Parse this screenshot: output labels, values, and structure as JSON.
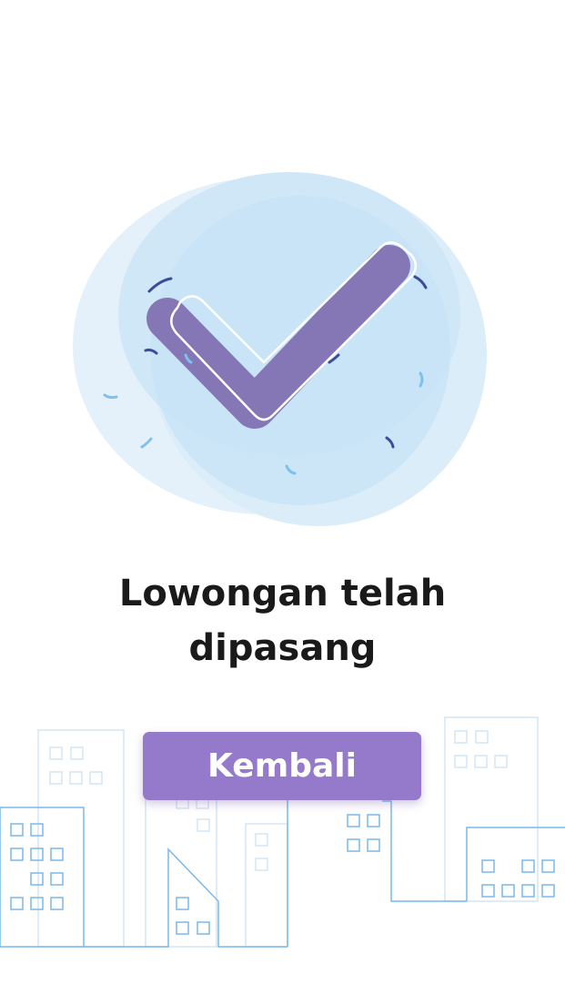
{
  "success_message": {
    "line1": "Lowongan telah",
    "line2": "dipasang"
  },
  "back_button": {
    "label": "Kembali"
  },
  "illustration": {
    "icon": "checkmark-icon",
    "check_color": "#8577b6",
    "circle_color": "#cfe6f7"
  },
  "background": {
    "icon": "city-skyline-icon",
    "line_color": "#7ab8ea"
  },
  "colors": {
    "accent": "#9579cb",
    "text": "#1a1a1a"
  }
}
